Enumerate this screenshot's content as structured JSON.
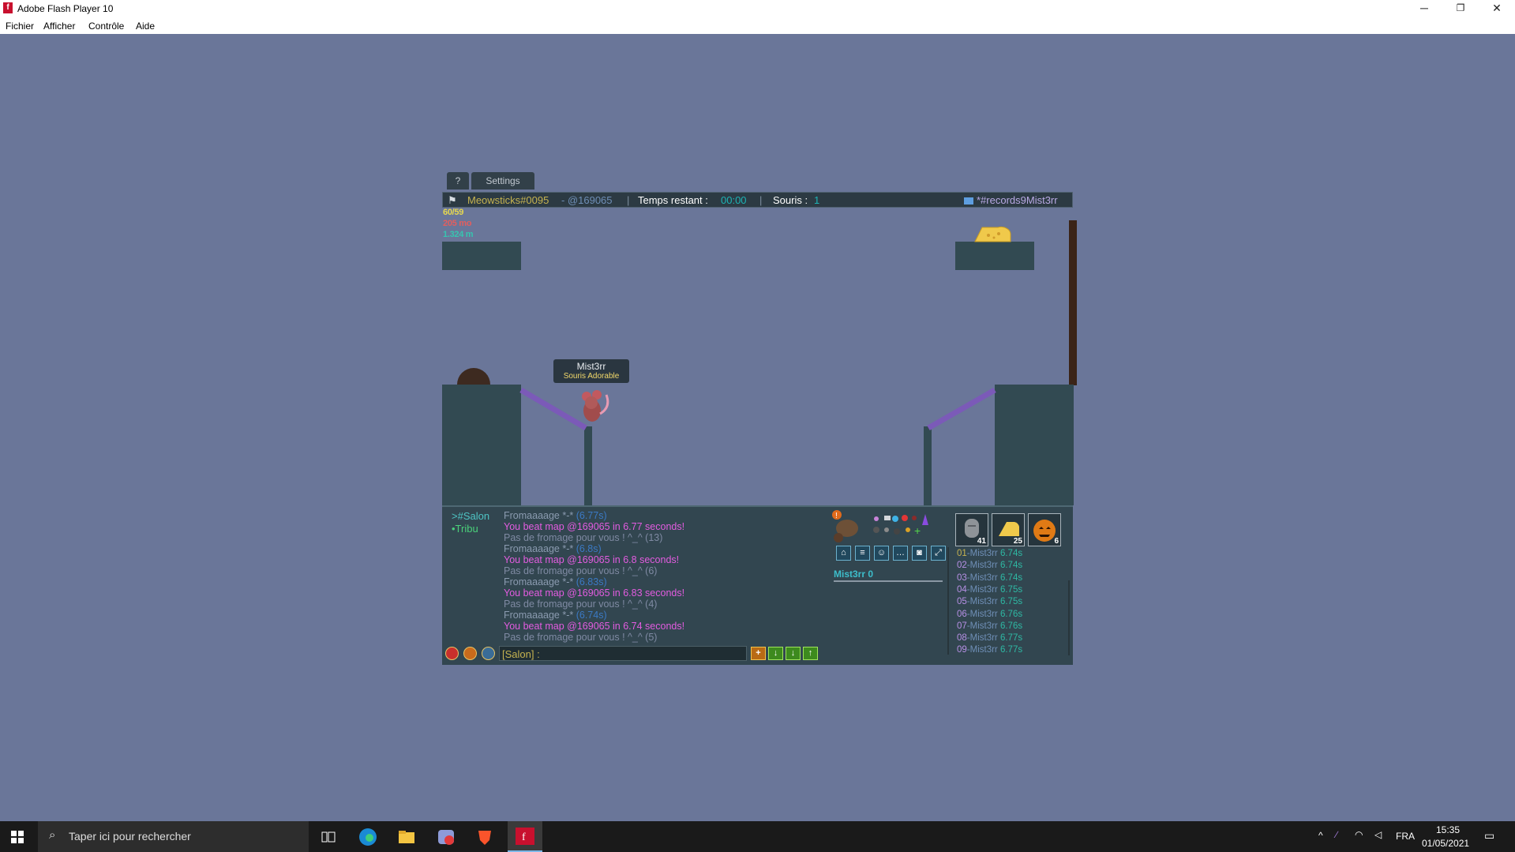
{
  "window": {
    "title": "Adobe Flash Player 10",
    "app_icon_letter": "f",
    "minimize": "─",
    "maximize": "❐",
    "close": "✕"
  },
  "menu": [
    "Fichier",
    "Afficher",
    "Contrôle",
    "Aide"
  ],
  "game": {
    "tabs": [
      "?",
      "Settings"
    ],
    "hud": {
      "player": "Meowsticks#0095",
      "map": "- @169065",
      "sep1": "|",
      "time_label": "Temps restant :",
      "time_value": "00:00",
      "sep2": "|",
      "mice_label": "Souris :",
      "mice_value": "1",
      "room": "*#records9Mist3rr"
    },
    "stats": {
      "fps": "60/59",
      "memory": "205 mo",
      "distance": "1.324 m"
    },
    "mouse_name": "Mist3rr",
    "mouse_title": "Souris Adorable"
  },
  "chat": {
    "channels": [
      ">#Salon",
      "•Tribu"
    ],
    "lines": [
      {
        "text": "Fromaaaage *-* ",
        "time": "(6.77s)",
        "kind": "cheese"
      },
      {
        "text": "You beat map @169065 in 6.77 seconds!",
        "time": "",
        "kind": "beat"
      },
      {
        "text": "Pas de fromage pour vous ! ^_^ (13)",
        "time": "",
        "kind": "nocheese"
      },
      {
        "text": "Fromaaaage *-* ",
        "time": "(6.8s)",
        "kind": "cheese"
      },
      {
        "text": "You beat map @169065 in 6.8 seconds!",
        "time": "",
        "kind": "beat"
      },
      {
        "text": "Pas de fromage pour vous ! ^_^ (6)",
        "time": "",
        "kind": "nocheese"
      },
      {
        "text": "Fromaaaage *-* ",
        "time": "(6.83s)",
        "kind": "cheese"
      },
      {
        "text": "You beat map @169065 in 6.83 seconds!",
        "time": "",
        "kind": "beat"
      },
      {
        "text": "Pas de fromage pour vous ! ^_^ (4)",
        "time": "",
        "kind": "nocheese"
      },
      {
        "text": "Fromaaaage *-* ",
        "time": "(6.74s)",
        "kind": "cheese"
      },
      {
        "text": "You beat map @169065 in 6.74 seconds!",
        "time": "",
        "kind": "beat"
      },
      {
        "text": "Pas de fromage pour vous ! ^_^ (5)",
        "time": "",
        "kind": "nocheese"
      }
    ],
    "input_prefix": "[Salon] :",
    "player_score": "Mist3rr 0",
    "slot_counts": [
      "41",
      "25",
      "6"
    ]
  },
  "ranking": [
    {
      "rank": "01",
      "name": "-Mist3rr",
      "time": " 6.74s"
    },
    {
      "rank": "02",
      "name": "-Mist3rr",
      "time": " 6.74s"
    },
    {
      "rank": "03",
      "name": "-Mist3rr",
      "time": " 6.74s"
    },
    {
      "rank": "04",
      "name": "-Mist3rr",
      "time": " 6.75s"
    },
    {
      "rank": "05",
      "name": "-Mist3rr",
      "time": " 6.75s"
    },
    {
      "rank": "06",
      "name": "-Mist3rr",
      "time": " 6.76s"
    },
    {
      "rank": "07",
      "name": "-Mist3rr",
      "time": " 6.76s"
    },
    {
      "rank": "08",
      "name": "-Mist3rr",
      "time": " 6.77s"
    },
    {
      "rank": "09",
      "name": "-Mist3rr",
      "time": " 6.77s"
    }
  ],
  "taskbar": {
    "search_placeholder": "Taper ici pour rechercher",
    "language": "FRA",
    "time": "15:35",
    "date": "01/05/2021"
  },
  "colors": {
    "stage_bg": "#6a7699",
    "platform": "#324a52",
    "hud_yellow": "#c6b350",
    "beat_pink": "#e35ce0",
    "cheese_text": "#8b9bb0",
    "nocheese_text": "#7f8aa3",
    "rank_green": "#2eb9a4"
  }
}
